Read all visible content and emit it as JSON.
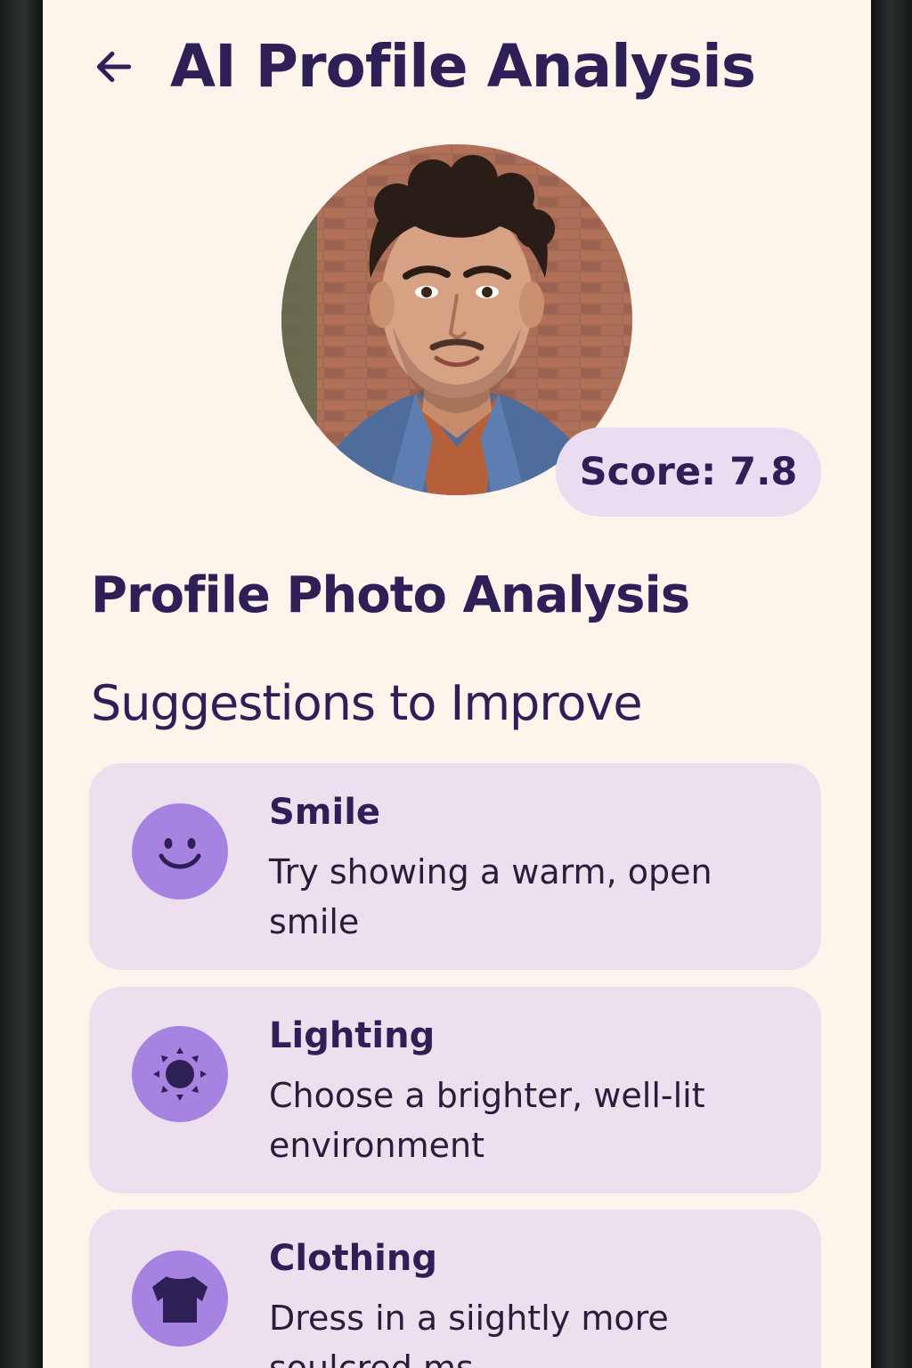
{
  "header": {
    "back_icon": "arrow-left-icon",
    "title": "AI Profile Analysis"
  },
  "profile": {
    "photo_description": "portrait photo",
    "score_label": "Score: 7.8",
    "score": 7.8
  },
  "main": {
    "section_title": "Profile Photo Analysis",
    "suggestions_title": "Suggestions to Improve"
  },
  "suggestions": [
    {
      "icon": "smile-icon",
      "title": "Smile",
      "description": "Try showing a warm, open smile"
    },
    {
      "icon": "sun-icon",
      "title": "Lighting",
      "description": "Choose a brighter, well-lit environment"
    },
    {
      "icon": "shirt-icon",
      "title": "Clothing",
      "description": "Dress in a siightly more soulcred ms"
    }
  ],
  "colors": {
    "background": "#fdf4ec",
    "primary_text": "#2e1f57",
    "card_background": "#ece0ee",
    "icon_circle": "#a683e0",
    "badge_background": "#eadcf1"
  }
}
